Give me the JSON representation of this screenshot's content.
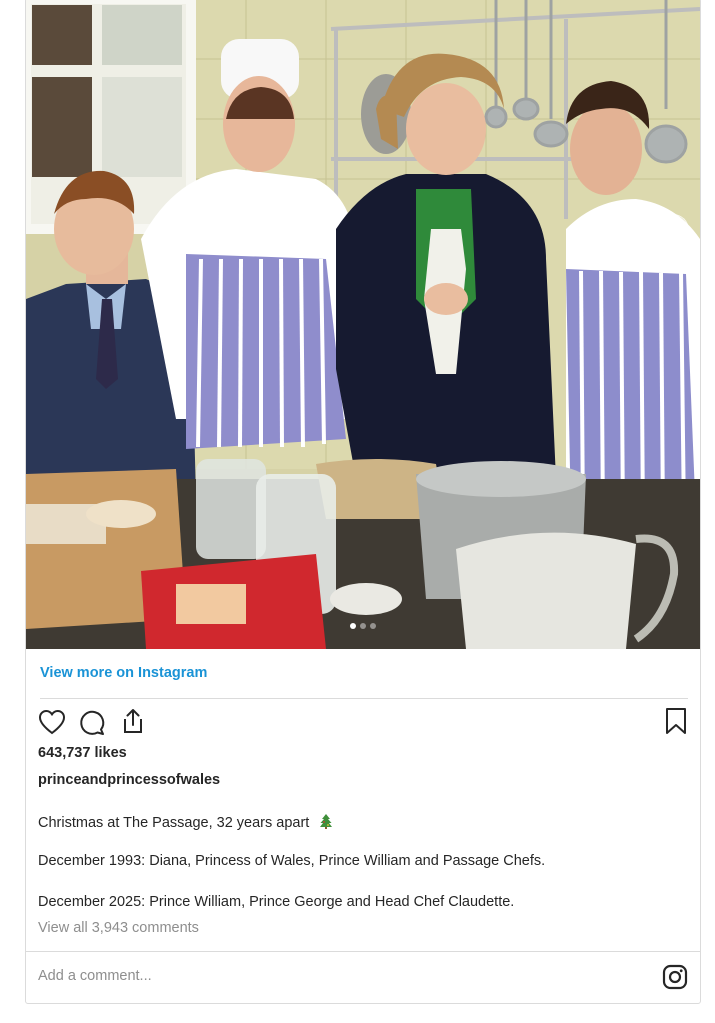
{
  "post": {
    "view_more_label": "View more on Instagram",
    "likes_text": "643,737 likes",
    "username": "princeandprincessofwales",
    "caption_title": "Christmas at The Passage, 32 years apart",
    "caption_line_1": "December 1993: Diana, Princess of Wales, Prince William and Passage Chefs.",
    "caption_line_2": "December 2025: Prince William, Prince George and Head Chef Claudette.",
    "comments_link": "View all 3,943 comments",
    "add_comment_placeholder": "Add a comment...",
    "carousel": {
      "slides": 3,
      "active_slide": 1
    }
  },
  "icons": {
    "like": "heart-icon",
    "comment": "comment-bubble-icon",
    "share": "share-icon",
    "save": "bookmark-icon",
    "brand": "instagram-icon",
    "next": "chevron-right-icon",
    "emoji": "christmas-tree-emoji"
  },
  "colors": {
    "link_blue": "#1a93d6",
    "text": "#262626",
    "muted": "#8e8e8e",
    "border": "#dbdbdb"
  }
}
